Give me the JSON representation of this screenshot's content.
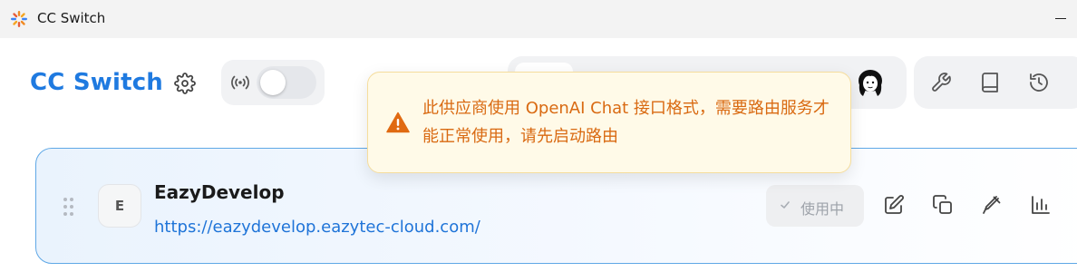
{
  "window": {
    "title": "CC Switch"
  },
  "header": {
    "brand": "CC Switch"
  },
  "toast": {
    "message": "此供应商使用 OpenAI Chat 接口格式，需要路由服务才能正常使用，请先启动路由"
  },
  "provider": {
    "avatar_letter": "E",
    "name": "EazyDevelop",
    "url": "https://eazydevelop.eazytec-cloud.com/",
    "status_label": "使用中"
  },
  "icons": {
    "settings": "gear-icon",
    "proxy": "signal-icon",
    "tools": [
      "wrench-icon",
      "book-icon",
      "history-icon"
    ],
    "actions": [
      "edit-icon",
      "copy-icon",
      "test-icon",
      "usage-chart-icon"
    ]
  },
  "colors": {
    "brand": "#1f7ae0",
    "warning": "#d96a12",
    "toast_bg": "#fffae8",
    "card_border": "#5fa8e6"
  }
}
